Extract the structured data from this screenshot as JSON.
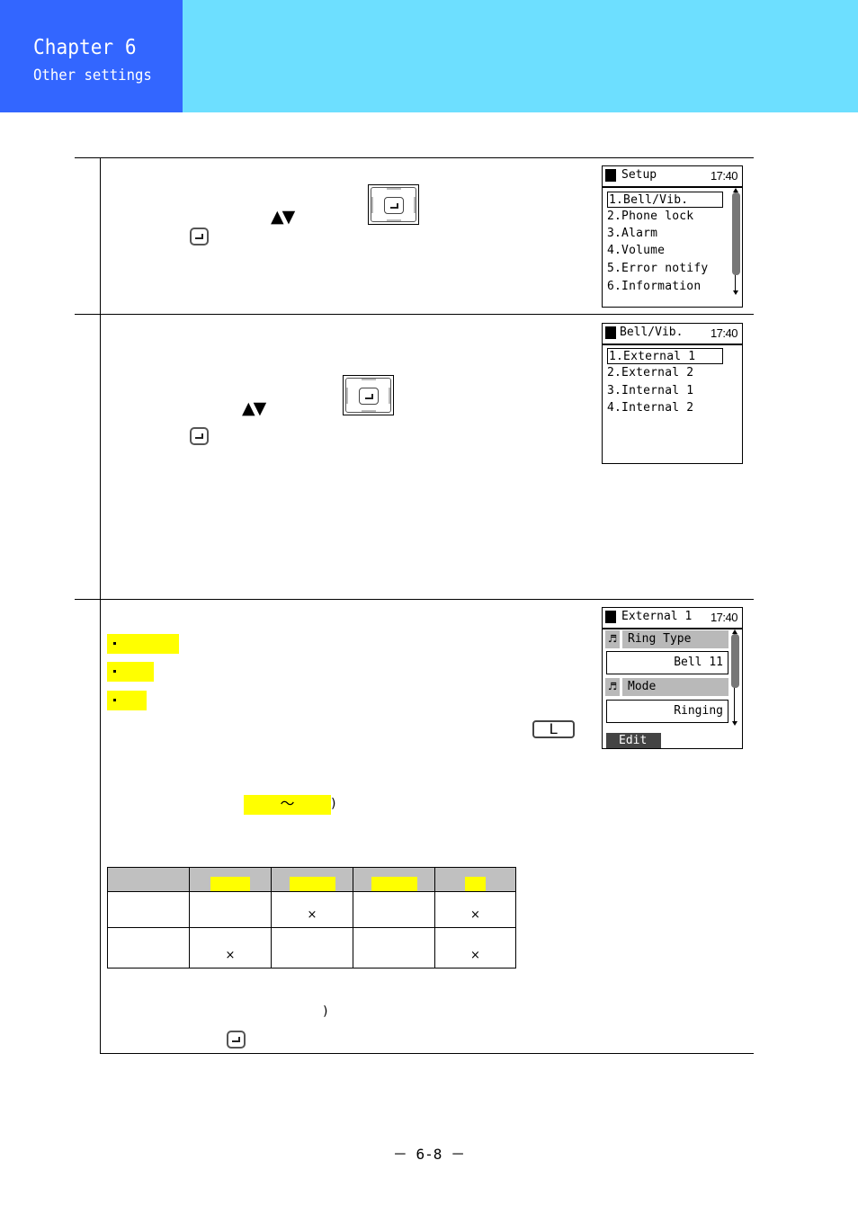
{
  "header": {
    "chapter": "Chapter 6",
    "subtitle": "Other settings",
    "colors": {
      "chapter_block": "#3366ff",
      "banner": "#6ddfff",
      "text": "#ffffff"
    }
  },
  "icons": {
    "enter_key": "enter-key-icon",
    "nav_pad": "navigation-pad-icon",
    "up_down_arrows": "▲▼",
    "l_key": "L"
  },
  "steps": [
    {
      "screen": {
        "title": "Setup",
        "time": "17:40",
        "items": [
          "1.Bell/Vib.",
          "2.Phone lock",
          "3.Alarm",
          "4.Volume",
          "5.Error notify",
          "6.Information"
        ],
        "selected_index": 0,
        "has_scrollbar": true
      }
    },
    {
      "screen": {
        "title": "Bell/Vib.",
        "time": "17:40",
        "items": [
          "1.External 1",
          "2.External 2",
          "3.Internal 1",
          "4.Internal 2"
        ],
        "selected_index": 0,
        "has_scrollbar": false
      }
    },
    {
      "bullets": [
        "·",
        "·",
        "·"
      ],
      "range_symbol": "～",
      "close_paren": ")",
      "close_paren_2": ")",
      "screen": {
        "title": "External 1",
        "time": "17:40",
        "fields": [
          {
            "icon": "music-note-icon",
            "label": "Ring Type",
            "value": "Bell 11"
          },
          {
            "icon": "music-mode-icon",
            "label": "Mode",
            "value": "Ringing"
          }
        ],
        "softkey": "Edit",
        "has_scrollbar": true
      },
      "table": {
        "header": [
          "",
          "",
          "",
          "",
          ""
        ],
        "rows": [
          [
            "",
            "",
            "×",
            "",
            "×"
          ],
          [
            "",
            "×",
            "",
            "",
            "×"
          ]
        ],
        "highlight_color": "#ffff00",
        "header_bg": "#c0c0c0"
      }
    }
  ],
  "footer": {
    "page_number": "－ 6-8 －"
  }
}
